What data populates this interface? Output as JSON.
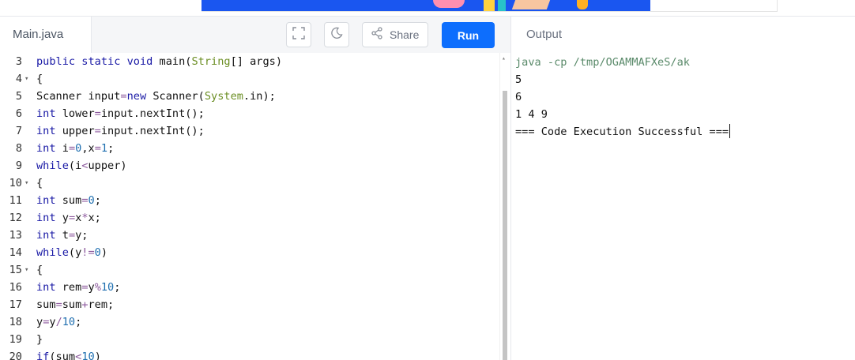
{
  "ad": {
    "accent_color": "#1a56f0"
  },
  "header": {
    "file_tab": "Main.java",
    "share_label": "Share",
    "run_label": "Run",
    "output_tab": "Output",
    "icons": [
      "fullscreen-icon",
      "dark-mode-icon",
      "share-icon"
    ]
  },
  "editor": {
    "lines": [
      {
        "n": "3",
        "fold": "",
        "html": "<span class=\"kw\">public</span> <span class=\"kw\">static</span> <span class=\"kw\">void</span> main(<span class=\"cls\">String</span>[] args)"
      },
      {
        "n": "4",
        "fold": "▾",
        "html": "{"
      },
      {
        "n": "5",
        "fold": "",
        "html": "Scanner input<span class=\"op\">=</span><span class=\"kw\">new</span> Scanner(<span class=\"cls\">System</span>.in);"
      },
      {
        "n": "6",
        "fold": "",
        "html": "<span class=\"kw\">int</span> lower<span class=\"op\">=</span>input.nextInt();"
      },
      {
        "n": "7",
        "fold": "",
        "html": "<span class=\"kw\">int</span> upper<span class=\"op\">=</span>input.nextInt();"
      },
      {
        "n": "8",
        "fold": "",
        "html": "<span class=\"kw\">int</span> i<span class=\"op\">=</span><span class=\"num\">0</span>,x<span class=\"op\">=</span><span class=\"num\">1</span>;"
      },
      {
        "n": "9",
        "fold": "",
        "html": "<span class=\"kw\">while</span>(i<span class=\"op\">&lt;</span>upper)"
      },
      {
        "n": "10",
        "fold": "▾",
        "html": "{"
      },
      {
        "n": "11",
        "fold": "",
        "html": "<span class=\"kw\">int</span> sum<span class=\"op\">=</span><span class=\"num\">0</span>;"
      },
      {
        "n": "12",
        "fold": "",
        "html": "<span class=\"kw\">int</span> y<span class=\"op\">=</span>x<span class=\"op\">*</span>x;"
      },
      {
        "n": "13",
        "fold": "",
        "html": "<span class=\"kw\">int</span> t<span class=\"op\">=</span>y;"
      },
      {
        "n": "14",
        "fold": "",
        "html": "<span class=\"kw\">while</span>(y<span class=\"op\">!=</span><span class=\"num\">0</span>)"
      },
      {
        "n": "15",
        "fold": "▾",
        "html": "{"
      },
      {
        "n": "16",
        "fold": "",
        "html": "<span class=\"kw\">int</span> rem<span class=\"op\">=</span>y<span class=\"op\">%</span><span class=\"num\">10</span>;"
      },
      {
        "n": "17",
        "fold": "",
        "html": "sum<span class=\"op\">=</span>sum<span class=\"op\">+</span>rem;"
      },
      {
        "n": "18",
        "fold": "",
        "html": "y<span class=\"op\">=</span>y<span class=\"op\">/</span><span class=\"num\">10</span>;"
      },
      {
        "n": "19",
        "fold": "",
        "html": "}"
      },
      {
        "n": "20",
        "fold": "",
        "html": "<span class=\"kw\">if</span>(sum<span class=\"op\">&lt;</span><span class=\"num\">10</span>)"
      }
    ]
  },
  "output": {
    "lines": [
      "java -cp /tmp/OGAMMAFXeS/ak",
      "5",
      "6",
      "1 4 9",
      "=== Code Execution Successful ==="
    ]
  }
}
